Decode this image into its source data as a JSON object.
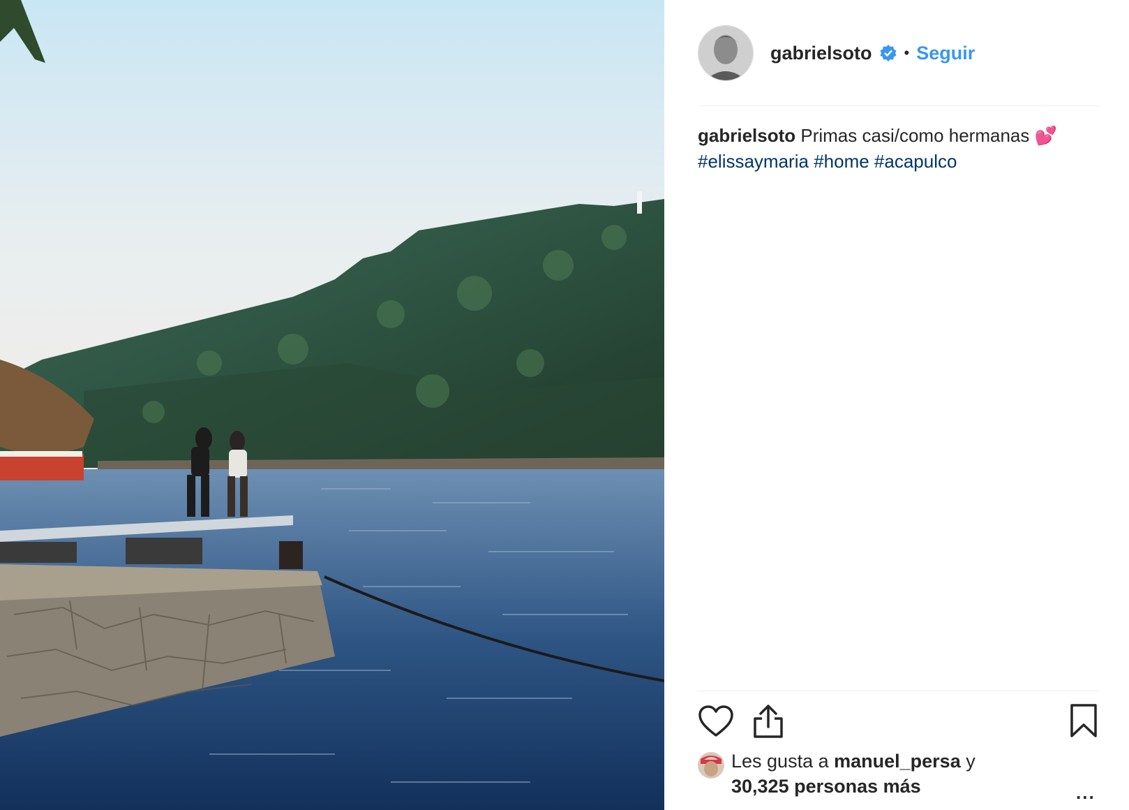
{
  "post": {
    "author": "gabrielsoto",
    "separator": "•",
    "follow_label": "Seguir",
    "caption": {
      "username": "gabrielsoto",
      "text": "Primas casi/como hermanas",
      "emoji": "💕",
      "hashtags": [
        "#elissaymaria",
        "#home",
        "#acapulco"
      ]
    },
    "likes": {
      "prefix": "Les gusta a",
      "user": "manuel_persa",
      "joiner": "y",
      "count_text": "30,325 personas más"
    },
    "more_label": "..."
  },
  "icons": {
    "like": "heart-icon",
    "share": "share-icon",
    "save": "bookmark-icon",
    "verified": "verified-badge-icon"
  },
  "colors": {
    "link": "#3897f0",
    "hashtag": "#003569",
    "verified": "#3897f0"
  }
}
